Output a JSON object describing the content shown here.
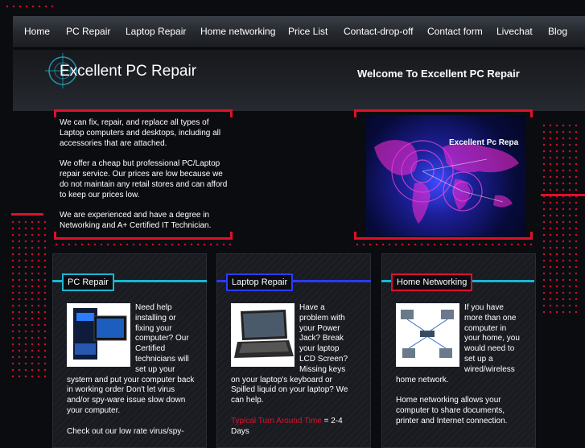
{
  "nav": {
    "items": [
      "Home",
      "PC Repair",
      "Laptop Repair",
      "Home networking",
      "Price List",
      "Contact-drop-off",
      "Contact form",
      "Livechat",
      "Blog"
    ]
  },
  "header": {
    "site_title": "Excellent PC Repair",
    "welcome": "Welcome To Excellent PC Repair"
  },
  "intro": {
    "paragraphs": [
      "We can fix, repair, and replace all types of Laptop computers and desktops, including all accessories that are attached.",
      "We offer a cheap but professional PC/Laptop repair service. Our prices are low because we do not maintain any retail stores and can afford to keep our prices low.",
      "We are experienced and have a degree in Networking and A+ Certified IT Technician."
    ]
  },
  "hero": {
    "caption": "Excellent Pc Repa"
  },
  "columns": [
    {
      "heading": "PC Repair",
      "text": "Need help installing or fixing your computer? Our Certified technicians will set up your system and put your computer back in working order Don't let virus and/or spy-ware issue slow down your computer.",
      "text2": "Check out our low rate virus/spy-"
    },
    {
      "heading": "Laptop Repair",
      "text": "Have a problem with your Power Jack? Break your laptop LCD Screen? Missing keys on your laptop's keyboard or Spilled liquid on your laptop? We can help.",
      "turnaround_label": "Typical Turn Around Time",
      "turnaround_value": "= 2-4 Days"
    },
    {
      "heading": "Home Networking",
      "text": "If you have more than one computer in your home, you would need to set up a wired/wireless home network.",
      "text2": "Home networking allows your computer to share documents, printer and Internet connection."
    }
  ],
  "colors": {
    "accent_red": "#e0102a",
    "pc_repair_cyan": "#19b6d2",
    "laptop_blue": "#2a3cff",
    "networking_red": "#e0102a"
  }
}
